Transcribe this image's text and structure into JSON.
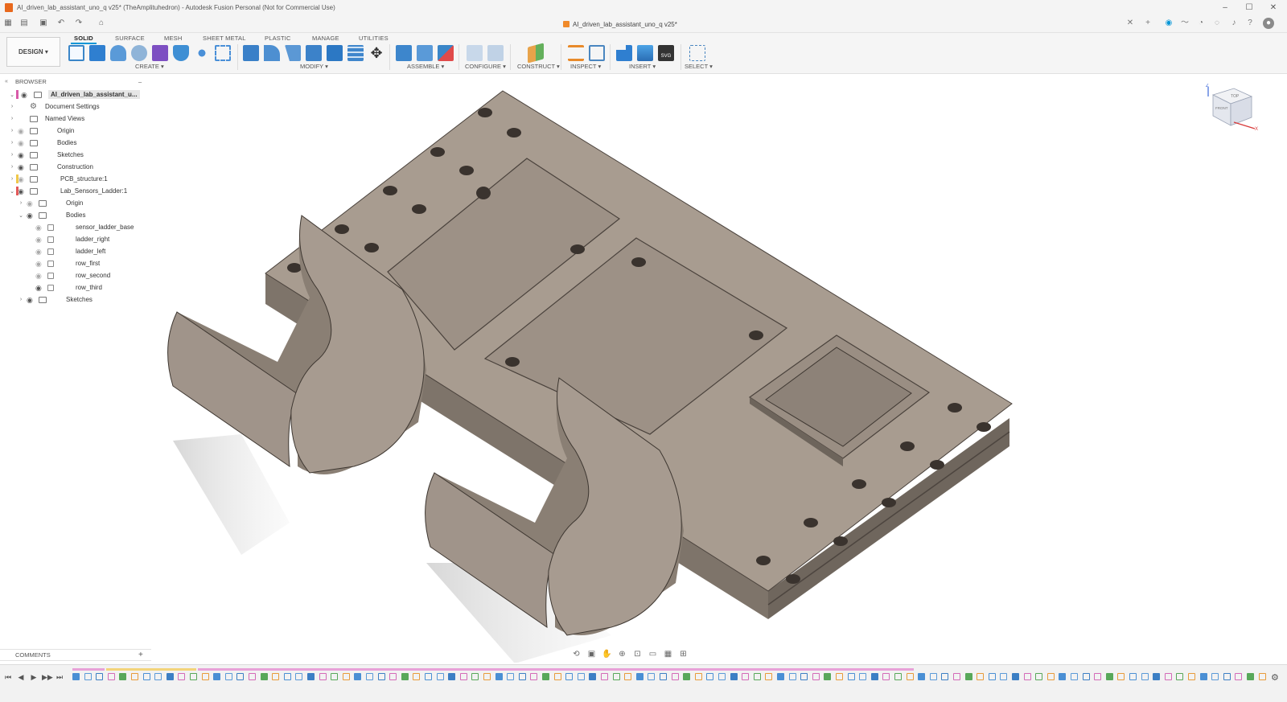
{
  "window": {
    "title": "AI_driven_lab_assistant_uno_q v25* (TheAmplituhedron) - Autodesk Fusion Personal (Not for Commercial Use)",
    "controls": [
      "–",
      "☐",
      "✕"
    ]
  },
  "document_tab": {
    "label": "AI_driven_lab_assistant_uno_q v25*",
    "close": "✕"
  },
  "workspace": {
    "label": "DESIGN ▾"
  },
  "ribbon": {
    "tabs": [
      "SOLID",
      "SURFACE",
      "MESH",
      "SHEET METAL",
      "PLASTIC",
      "MANAGE",
      "UTILITIES"
    ],
    "active_tab": "SOLID",
    "groups": [
      "CREATE ▾",
      "MODIFY ▾",
      "ASSEMBLE ▾",
      "CONFIGURE ▾",
      "CONSTRUCT ▾",
      "INSPECT ▾",
      "INSERT ▾",
      "SELECT ▾"
    ]
  },
  "browser": {
    "header": "BROWSER",
    "collapse": "–",
    "root": "AI_driven_lab_assistant_u...",
    "items": [
      {
        "label": "Document Settings",
        "level": 1
      },
      {
        "label": "Named Views",
        "level": 1
      },
      {
        "label": "Origin",
        "level": 1
      },
      {
        "label": "Bodies",
        "level": 1
      },
      {
        "label": "Sketches",
        "level": 1
      },
      {
        "label": "Construction",
        "level": 1
      },
      {
        "label": "PCB_structure:1",
        "level": 1
      },
      {
        "label": "Lab_Sensors_Ladder:1",
        "level": 1
      },
      {
        "label": "Origin",
        "level": 2
      },
      {
        "label": "Bodies",
        "level": 2
      },
      {
        "label": "sensor_ladder_base",
        "level": 3
      },
      {
        "label": "ladder_right",
        "level": 3
      },
      {
        "label": "ladder_left",
        "level": 3
      },
      {
        "label": "row_first",
        "level": 3
      },
      {
        "label": "row_second",
        "level": 3
      },
      {
        "label": "row_third",
        "level": 3
      },
      {
        "label": "Sketches",
        "level": 2
      }
    ]
  },
  "comments": {
    "label": "COMMENTS",
    "add": "+"
  },
  "viewcube": {
    "top_face": "TOP",
    "front_face": "FRONT",
    "axis_z": "Z",
    "axis_x": "X"
  },
  "colors": {
    "model_top": "#a69a8e",
    "model_side": "#8b8075",
    "model_dark": "#6f655c",
    "accent": "#0696d7",
    "timeline_pink": "#e8a1d8",
    "timeline_yellow": "#f3d47a"
  },
  "timeline": {
    "controls": [
      "⏮",
      "◀",
      "▶",
      "▶▶",
      "⏭"
    ]
  }
}
